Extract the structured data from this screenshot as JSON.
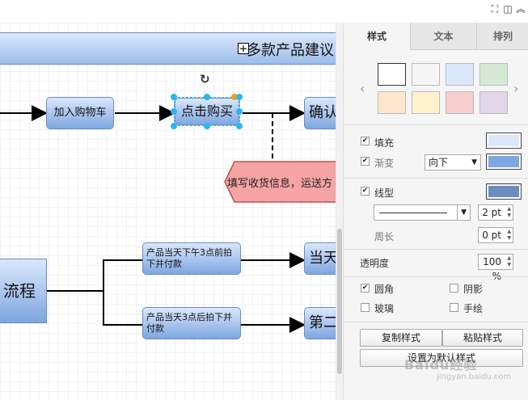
{
  "canvas": {
    "banner_title": "多款产品建议",
    "nodes": {
      "add_to_cart": "加入购物车",
      "click_buy": "点击购买",
      "confirm": "确认",
      "process": "流程",
      "before3pm": "产品当天下午3点前拍下并付款",
      "after3pm": "产品当天3点后拍下并付款",
      "same_day": "当天",
      "next_day": "第二"
    },
    "callout": "填写收货信息，运送方"
  },
  "panel": {
    "tabs": [
      "样式",
      "文本",
      "排列"
    ],
    "swatches": [
      "#ffffff",
      "#f5f5f5",
      "#dae8fc",
      "#d5e8d4",
      "#ffe6cc",
      "#fff2cc",
      "#f8cecc",
      "#e1d5e7"
    ],
    "fill": {
      "label": "填充",
      "checked": true,
      "color": "#dae8fc"
    },
    "gradient": {
      "label": "渐变",
      "checked": true,
      "direction": "向下",
      "color": "#7ea6e0"
    },
    "line": {
      "label": "线型",
      "checked": true,
      "color": "#6c8ebf",
      "width": "2 pt"
    },
    "perimeter": {
      "label": "周长",
      "value": "0 pt"
    },
    "opacity": {
      "label": "透明度",
      "value": "100 %"
    },
    "rounded": {
      "label": "圆角",
      "checked": true
    },
    "shadow": {
      "label": "阴影",
      "checked": false
    },
    "glass": {
      "label": "玻璃",
      "checked": false
    },
    "sketch": {
      "label": "手绘",
      "checked": false
    },
    "copy_style": "复制样式",
    "paste_style": "粘贴样式",
    "set_default": "设置为默认样式"
  },
  "watermark": "Baidu经验",
  "watermark_sub": "jingyan.baidu.com"
}
